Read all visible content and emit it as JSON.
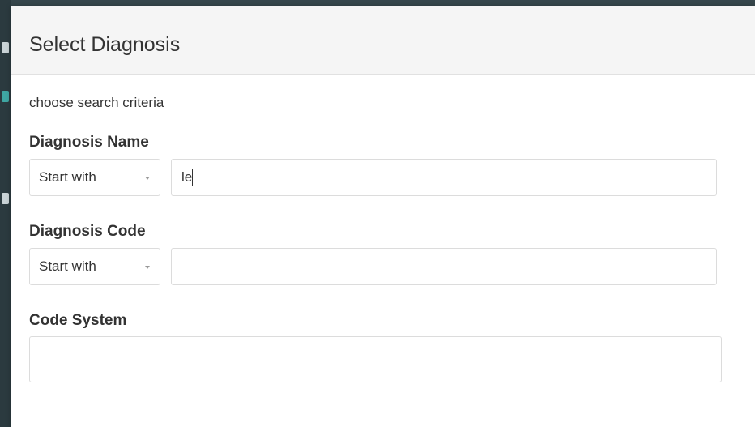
{
  "dialog": {
    "title": "Select Diagnosis",
    "hint": "choose search criteria"
  },
  "fields": {
    "diagnosis_name": {
      "label": "Diagnosis Name",
      "match_mode": "Start with",
      "value": "le"
    },
    "diagnosis_code": {
      "label": "Diagnosis Code",
      "match_mode": "Start with",
      "value": ""
    },
    "code_system": {
      "label": "Code System",
      "value": ""
    }
  },
  "colors": {
    "header_bg": "#f5f5f5",
    "text": "#333333",
    "border": "#dcdcdc",
    "backdrop": "#37474c"
  }
}
